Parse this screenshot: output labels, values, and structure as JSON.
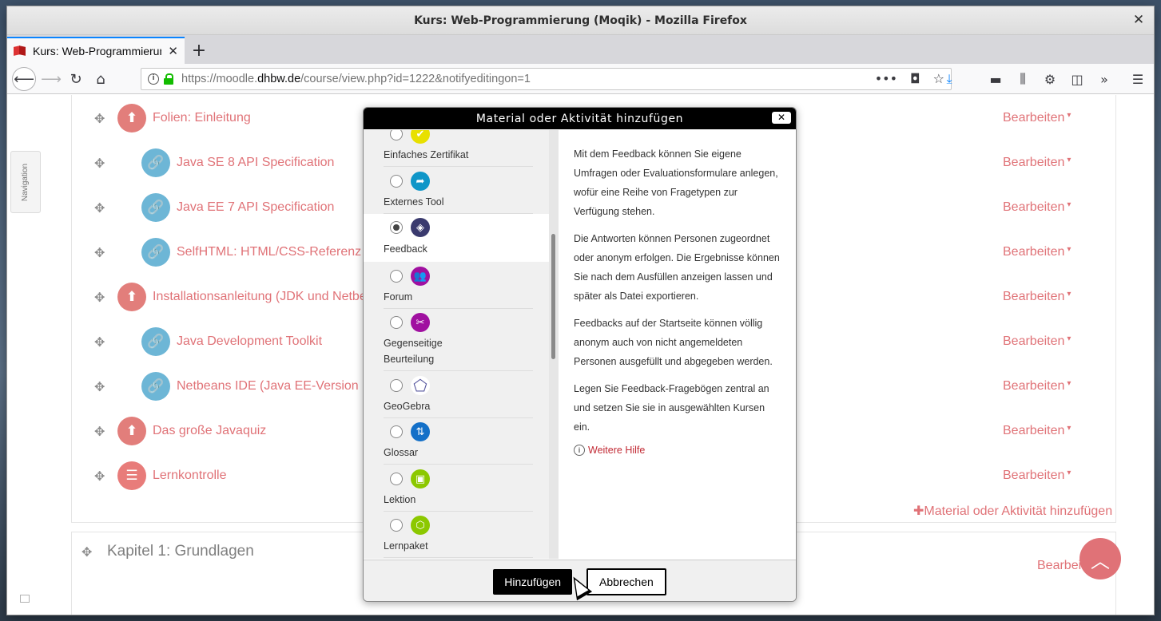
{
  "window": {
    "title": "Kurs: Web-Programmierung (Moqik) - Mozilla Firefox"
  },
  "tab": {
    "title": "Kurs: Web-Programmierun",
    "close_glyph": "✕"
  },
  "newtab": {
    "glyph": "+"
  },
  "nav": {
    "url_prefix": "https://moodle.",
    "url_domain": "dhbw.de",
    "url_path": "/course/view.php?id=1222&notifyeditingon=1",
    "back_glyph": "⟵",
    "forward_glyph": "⟶",
    "reload_glyph": "↻",
    "home_glyph": "⌂",
    "more_glyph": "•••",
    "pocket_glyph": "◘",
    "star_glyph": "☆",
    "download_glyph": "⤓",
    "library_glyph": "⫼",
    "extension_glyph": "⚙",
    "sidebar_glyph": "◫",
    "overflow_glyph": "»",
    "menu_glyph": "☰"
  },
  "navigation_drawer": {
    "label": "Navigation"
  },
  "activities": [
    {
      "label": "Folien: Einleitung",
      "type": "pdf",
      "edit": "Bearbeiten"
    },
    {
      "label": "Java SE 8 API Specification",
      "type": "url",
      "edit": "Bearbeiten"
    },
    {
      "label": "Java EE 7 API Specification",
      "type": "url",
      "edit": "Bearbeiten"
    },
    {
      "label": "SelfHTML: HTML/CSS-Referenz",
      "type": "url",
      "edit": "Bearbeiten"
    },
    {
      "label": "Installationsanleitung (JDK und Netbe",
      "type": "pdf",
      "edit": "Bearbeiten"
    },
    {
      "label": "Java Development Toolkit",
      "type": "url",
      "edit": "Bearbeiten"
    },
    {
      "label": "Netbeans IDE (Java EE-Version n",
      "type": "url",
      "edit": "Bearbeiten"
    },
    {
      "label": "Das große Javaquiz",
      "type": "pdf",
      "edit": "Bearbeiten"
    },
    {
      "label": "Lernkontrolle",
      "type": "quiz",
      "edit": "Bearbeiten"
    }
  ],
  "add_activity_link": "Material oder Aktivität hinzufügen",
  "section2": {
    "title": "Kapitel 1: Grundlagen",
    "edit": "Bearbei"
  },
  "modal": {
    "title": "Material oder Aktivität hinzufügen",
    "close_glyph": "✕",
    "options": [
      {
        "label": "Einfaches Zertifikat",
        "icon": "certificate-icon",
        "color": "#e8e000",
        "glyph": "✔",
        "selected": false
      },
      {
        "label": "Externes Tool",
        "icon": "external-tool-icon",
        "color": "#0f96c8",
        "glyph": "➦",
        "selected": false
      },
      {
        "label": "Feedback",
        "icon": "feedback-icon",
        "color": "#3a3a6e",
        "glyph": "◈",
        "selected": true
      },
      {
        "label": "Forum",
        "icon": "forum-icon",
        "color": "#a010a0",
        "glyph": "👥",
        "selected": false
      },
      {
        "label": "Gegenseitige Beurteilung",
        "icon": "workshop-icon",
        "color": "#a010a0",
        "glyph": "✂",
        "selected": false
      },
      {
        "label": "GeoGebra",
        "icon": "geogebra-icon",
        "color": "#ffffff",
        "glyph": "⬠",
        "selected": false
      },
      {
        "label": "Glossar",
        "icon": "glossary-icon",
        "color": "#1470c8",
        "glyph": "⇅",
        "selected": false
      },
      {
        "label": "Lektion",
        "icon": "lesson-icon",
        "color": "#8cc800",
        "glyph": "▣",
        "selected": false
      },
      {
        "label": "Lernpaket",
        "icon": "scorm-icon",
        "color": "#8cc800",
        "glyph": "⬡",
        "selected": false
      }
    ],
    "help_paragraphs": [
      "Mit dem Feedback können Sie eigene Umfragen oder Evaluationsformulare anlegen, wofür eine Reihe von Fragetypen zur Verfügung stehen.",
      "Die Antworten können Personen zugeordnet oder anonym erfolgen. Die Ergebnisse können Sie nach dem Ausfüllen anzeigen lassen und später als Datei exportieren.",
      "Feedbacks auf der Startseite können völlig anonym auch von nicht angemeldeten Personen ausgefüllt und abgegeben werden.",
      "Legen Sie Feedback-Fragebögen zentral an und setzen Sie sie in ausgewählten Kursen ein."
    ],
    "more_help": "Weitere Hilfe",
    "add_button": "Hinzufügen",
    "cancel_button": "Abbrechen"
  }
}
